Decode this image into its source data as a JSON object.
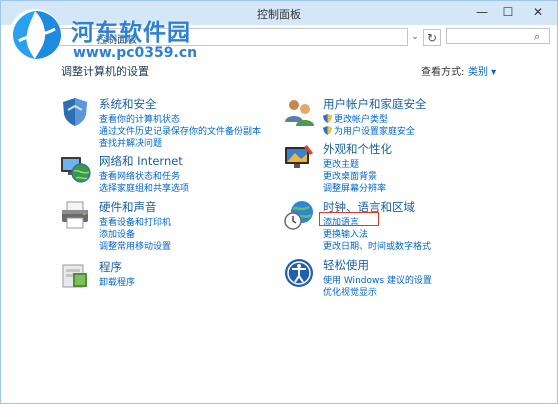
{
  "window": {
    "title": "控制面板"
  },
  "watermark": {
    "site_name": "河东软件园",
    "url": "www.pc0359.cn"
  },
  "toolbar": {
    "breadcrumb": "控制面板",
    "breadcrumb_sep": "›",
    "dropdown_glyph": "⌄",
    "refresh_glyph": "↻",
    "search_placeholder": "",
    "search_glyph": "⌕"
  },
  "header": {
    "heading": "调整计算机的设置",
    "view_by_label": "查看方式:",
    "view_by_value": "类别 ▾"
  },
  "categories": [
    {
      "id": "system-security",
      "title": "系统和安全",
      "links": [
        "查看你的计算机状态",
        "通过文件历史记录保存你的文件备份副本",
        "查找并解决问题"
      ]
    },
    {
      "id": "network",
      "title": "网络和 Internet",
      "links": [
        "查看网络状态和任务",
        "选择家庭组和共享选项"
      ]
    },
    {
      "id": "hardware",
      "title": "硬件和声音",
      "links": [
        "查看设备和打印机",
        "添加设备",
        "调整常用移动设置"
      ]
    },
    {
      "id": "programs",
      "title": "程序",
      "links": [
        "卸载程序"
      ]
    },
    {
      "id": "accounts",
      "title": "用户帐户和家庭安全",
      "links": [
        "更改帐户类型",
        "为用户设置家庭安全"
      ]
    },
    {
      "id": "appearance",
      "title": "外观和个性化",
      "links": [
        "更改主题",
        "更改桌面背景",
        "调整屏幕分辨率"
      ]
    },
    {
      "id": "clock-language",
      "title": "时钟、语言和区域",
      "links": [
        "添加语言",
        "更换输入法",
        "更改日期、时间或数字格式"
      ]
    },
    {
      "id": "ease",
      "title": "轻松使用",
      "links": [
        "使用 Windows 建议的设置",
        "优化视觉显示"
      ]
    }
  ],
  "window_controls": {
    "minimize": "—",
    "maximize": "☐",
    "close": "✕"
  },
  "colors": {
    "title_bar": "#d4e7f7",
    "link": "#0066cc",
    "category_title": "#1b5f9e",
    "highlight": "#e23b2e"
  }
}
